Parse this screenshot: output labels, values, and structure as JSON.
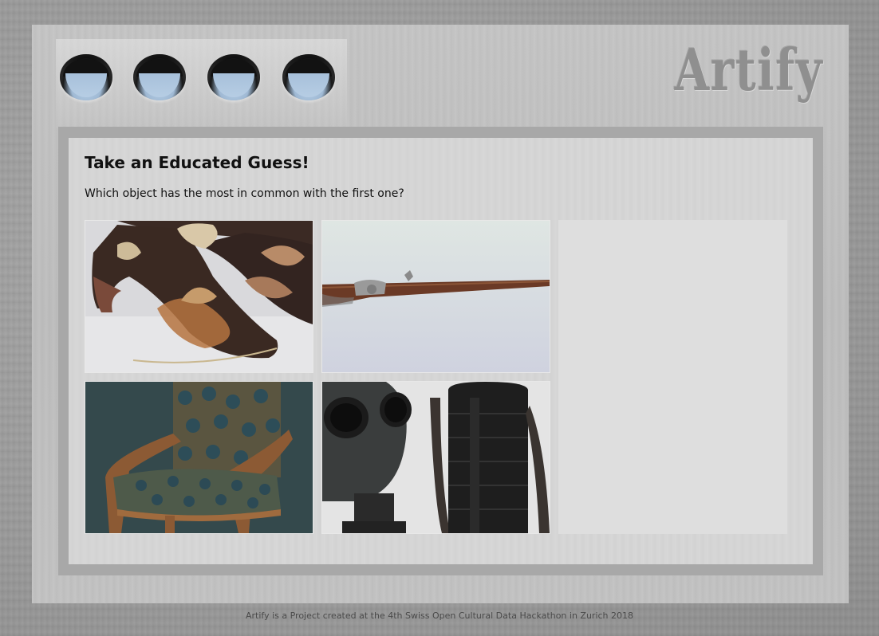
{
  "app": {
    "brand": "Artify"
  },
  "quiz": {
    "title": "Take an Educated Guess!",
    "question": "Which object has the most in common with the first one?",
    "options": [
      {
        "subject": "embroidered shoes"
      },
      {
        "subject": "flintlock musket"
      },
      {
        "subject": "upholstered armchair"
      },
      {
        "subject": "gas mask with canister"
      }
    ]
  },
  "footer": {
    "text": "Artify is a Project created at the 4th Swiss Open Cultural Data Hackathon in Zurich 2018"
  },
  "theme": {
    "background": "#9e9e9e",
    "panel": "#d6d6d6",
    "panel_border": "#a8a8a8",
    "sky_blue": "#b6cde4"
  }
}
